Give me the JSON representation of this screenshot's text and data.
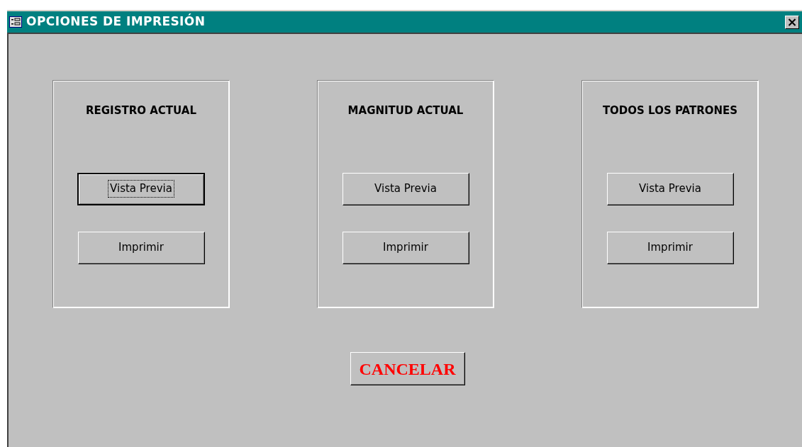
{
  "window": {
    "title": "OPCIONES DE IMPRESIÓN",
    "close": "×"
  },
  "groups": [
    {
      "title": "REGISTRO ACTUAL",
      "buttons": [
        {
          "label": "Vista Previa",
          "focused": true
        },
        {
          "label": "Imprimir",
          "focused": false
        }
      ]
    },
    {
      "title": "MAGNITUD ACTUAL",
      "buttons": [
        {
          "label": "Vista Previa",
          "focused": false
        },
        {
          "label": "Imprimir",
          "focused": false
        }
      ]
    },
    {
      "title": "TODOS LOS PATRONES",
      "buttons": [
        {
          "label": "Vista Previa",
          "focused": false
        },
        {
          "label": "Imprimir",
          "focused": false
        }
      ]
    }
  ],
  "cancel": {
    "label": "CANCELAR"
  }
}
